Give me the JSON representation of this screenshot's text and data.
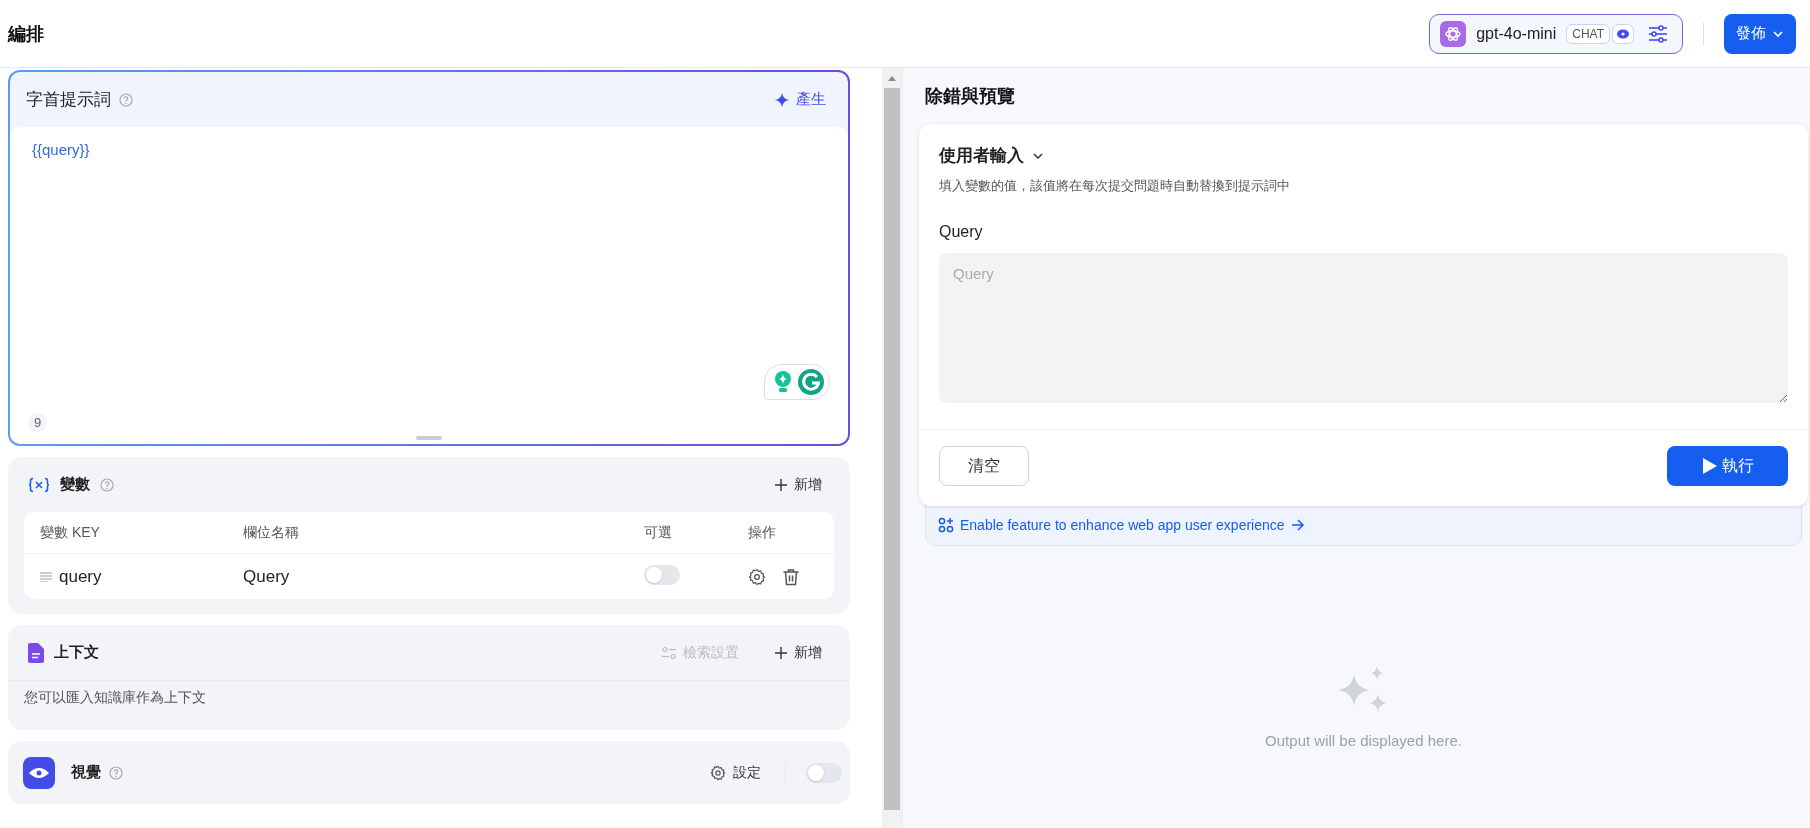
{
  "header": {
    "title": "編排",
    "model": {
      "name": "gpt-4o-mini",
      "badge": "CHAT"
    },
    "publish_button": "發佈"
  },
  "prompt": {
    "title": "字首提示詞",
    "generate_button": "產生",
    "content": "{{query}}",
    "char_count": "9"
  },
  "variables": {
    "title": "變數",
    "add_button": "新增",
    "columns": [
      "變數 KEY",
      "欄位名稱",
      "可選",
      "操作"
    ],
    "rows": [
      {
        "key": "query",
        "name": "Query",
        "optional": false
      }
    ]
  },
  "context": {
    "title": "上下文",
    "retrieval_button": "檢索設置",
    "add_button": "新增",
    "hint": "您可以匯入知識庫作為上下文"
  },
  "vision": {
    "title": "視覺",
    "settings_button": "設定",
    "on": false
  },
  "preview": {
    "title": "除錯與預覽",
    "user_input_title": "使用者輸入",
    "description": "填入變數的值，該值將在每次提交問題時自動替換到提示詞中",
    "fields": [
      {
        "label": "Query",
        "placeholder": "Query"
      }
    ],
    "clear_button": "清空",
    "run_button": "執行",
    "feature_banner": "Enable feature to enhance web app user experience",
    "output_placeholder": "Output will be displayed here."
  }
}
